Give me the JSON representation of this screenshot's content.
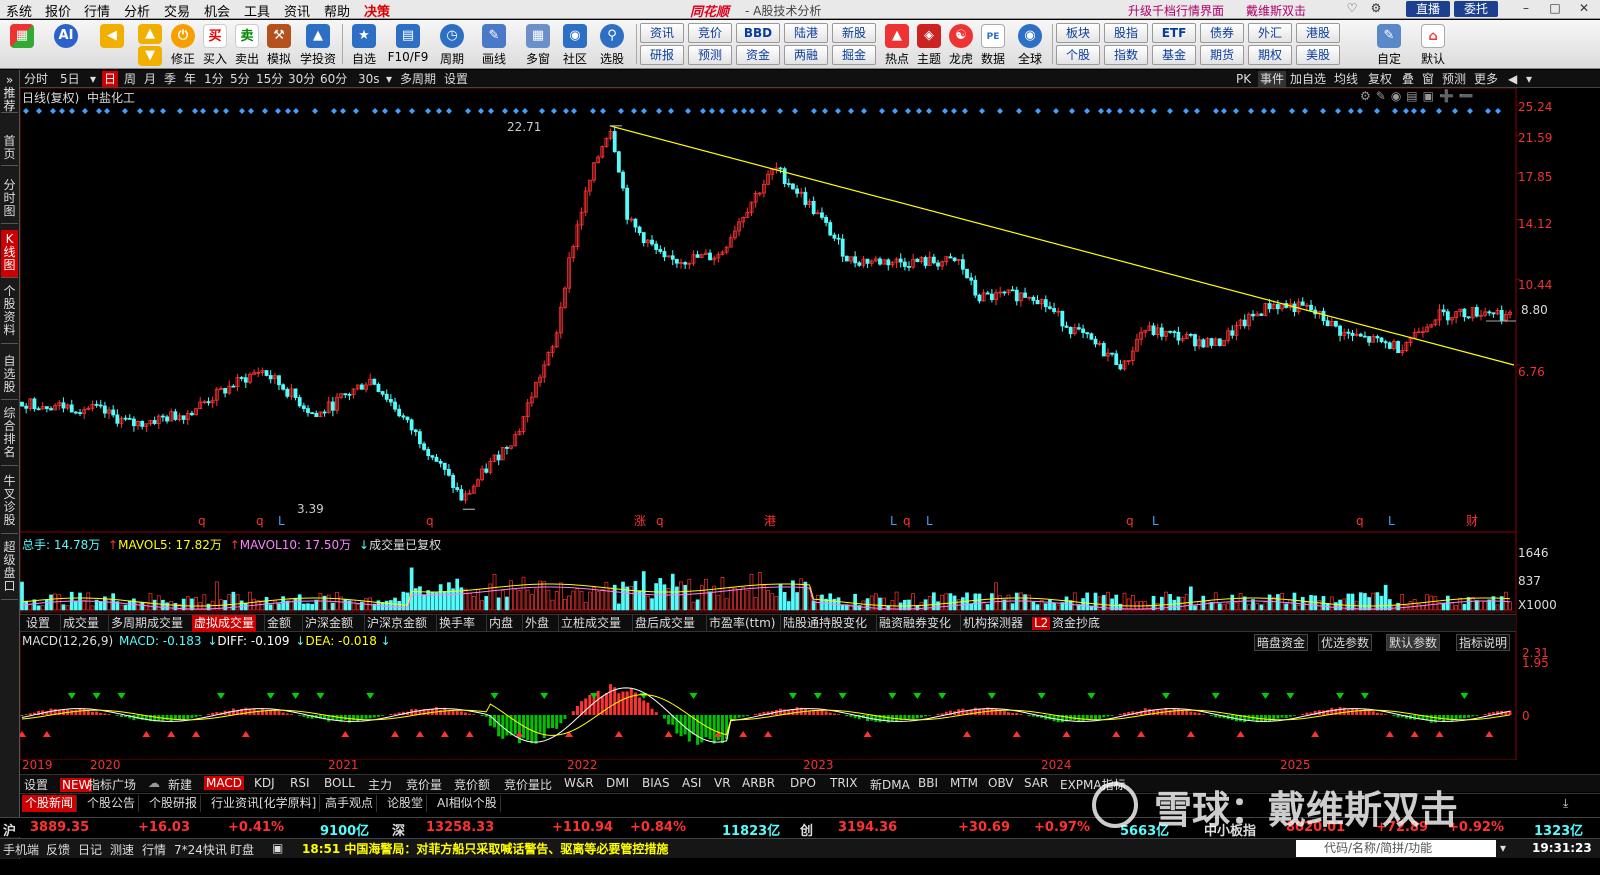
{
  "menubar": {
    "items": [
      "系统",
      "报价",
      "行情",
      "分析",
      "交易",
      "机会",
      "工具",
      "资讯",
      "帮助",
      "决策"
    ],
    "brand": "同花顺",
    "title": "- A股技术分析",
    "promo1": "升级千档行情界面",
    "promo2": "戴维斯双击",
    "btn1": "直播",
    "btn2": "委托"
  },
  "toolbar": {
    "big": [
      "修正",
      "买入",
      "卖出",
      "模拟",
      "学投资",
      "自选",
      "F10/F9",
      "周期",
      "画线",
      "多窗",
      "社区",
      "选股",
      "热点",
      "主题",
      "龙虎",
      "数据",
      "全球"
    ],
    "grid_top": [
      "资讯",
      "竞价",
      "BBD",
      "陆港",
      "新股"
    ],
    "grid_bottom": [
      "研报",
      "预测",
      "资金",
      "两融",
      "掘金"
    ],
    "grid2_top": [
      "板块",
      "股指",
      "ETF",
      "债券",
      "外汇",
      "港股"
    ],
    "grid2_bottom": [
      "个股",
      "指数",
      "基金",
      "期货",
      "期权",
      "美股"
    ],
    "right": [
      "自定",
      "默认"
    ]
  },
  "lefttabs": [
    "推荐",
    "首页",
    "分时图",
    "K线图",
    "个股资料",
    "自选股",
    "综合排名",
    "牛叉诊股",
    "超级盘口"
  ],
  "periods": [
    "分时",
    "5日",
    "日",
    "周",
    "月",
    "季",
    "年",
    "1分",
    "5分",
    "15分",
    "30分",
    "60分",
    "30s",
    "多周期",
    "设置"
  ],
  "period_active": "日",
  "periodbar_right": [
    "PK",
    "事件",
    "加自选",
    "均线",
    "复权",
    "叠",
    "窗",
    "预测",
    "更多"
  ],
  "chart_header": "日线(复权)  中盐化工",
  "price_axis": [
    "25.24",
    "21.59",
    "17.85",
    "14.12",
    "10.44",
    "6.76"
  ],
  "annotations": {
    "high": "22.71",
    "low": "3.39",
    "last": "8.80"
  },
  "event_markers": [
    "q",
    "q",
    "L",
    "q",
    "涨",
    "q",
    "港",
    "L",
    "q",
    "L",
    "q",
    "L",
    "q",
    "L",
    "财"
  ],
  "volume_legend": {
    "total": "总手: 14.78万",
    "mavol5": "MAVOL5: 17.82万",
    "mavol10": "MAVOL10: 17.50万",
    "note": "成交量已复权"
  },
  "volume_axis": [
    "1646",
    "837",
    "X1000"
  ],
  "indicator_tabs": [
    "设置",
    "成交量",
    "多周期成交量",
    "虚拟成交量",
    "金额",
    "沪深金额",
    "沪深京金额",
    "换手率",
    "内盘",
    "外盘",
    "立桩成交量",
    "盘后成交量",
    "市盈率(ttm)",
    "陆股通持股变化",
    "融资融券变化",
    "机构探测器",
    "L2",
    "资金抄底"
  ],
  "indicator_active": "虚拟成交量",
  "macd_legend": {
    "name": "MACD(12,26,9)",
    "macd": "MACD: -0.183",
    "diff": "DIFF: -0.109",
    "dea": "DEA: -0.018"
  },
  "macd_buttons": [
    "暗盘资金",
    "优选参数",
    "默认参数",
    "指标说明"
  ],
  "macd_axis": [
    "2.31",
    "1.95",
    "0"
  ],
  "years": [
    "2019",
    "2020",
    "2021",
    "2022",
    "2023",
    "2024",
    "2025"
  ],
  "indicators": [
    "设置",
    "NEW",
    "指标广场",
    "新建",
    "MACD",
    "KDJ",
    "RSI",
    "BOLL",
    "主力",
    "竞价量",
    "竞价额",
    "竞价量比",
    "W&R",
    "DMI",
    "BIAS",
    "ASI",
    "VR",
    "ARBR",
    "DPO",
    "TRIX",
    "新DMA",
    "BBI",
    "MTM",
    "OBV",
    "SAR",
    "EXPMA指标"
  ],
  "news_tabs": [
    "个股新闻",
    "个股公告",
    "个股研报",
    "行业资讯[化学原料]",
    "高手观点",
    "论股堂",
    "AI相似个股"
  ],
  "watermark": "雪球：戴维斯双击",
  "indices": [
    {
      "name": "沪",
      "value": "3889.35",
      "chg": "+16.03",
      "pct": "+0.41%",
      "amt": "9100亿"
    },
    {
      "name": "深",
      "value": "13258.33",
      "chg": "+110.94",
      "pct": "+0.84%",
      "amt": "11823亿"
    },
    {
      "name": "创",
      "value": "3194.36",
      "chg": "+30.69",
      "pct": "+0.97%",
      "amt": "5663亿"
    },
    {
      "name": "中小板指",
      "value": "8020.01",
      "chg": "+72.89",
      "pct": "+0.92%",
      "amt": "1323亿"
    }
  ],
  "statusbar": {
    "items": [
      "手机端",
      "反馈",
      "日记",
      "测速",
      "行情",
      "7*24快讯",
      "盯盘"
    ],
    "ticker": "18:51 中国海警局：对菲方船只采取喊话警告、驱离等必要管控措施",
    "search": "代码/名称/简拼/功能",
    "clock": "19:31:23"
  },
  "colors": {
    "up": "#ff3232",
    "down": "#54fcfc",
    "trend": "#ffff00",
    "mavol5": "#ffff00",
    "mavol10": "#ff80ff",
    "diff": "#ffffff",
    "dea": "#ffff00"
  },
  "chart_data": {
    "type": "candlestick",
    "title": "日线(复权)  中盐化工",
    "x_range": [
      "2019",
      "2025"
    ],
    "price_range": [
      3.39,
      22.71
    ],
    "price_ticks": [
      25.24,
      21.59,
      17.85,
      14.12,
      10.44,
      6.76
    ],
    "trend_line": {
      "from": 22.71,
      "to": 6.76
    },
    "series_anchors": [
      {
        "x": "2019-01",
        "price": 5.6
      },
      {
        "x": "2019-05",
        "price": 5.4
      },
      {
        "x": "2019-07",
        "price": 5.0
      },
      {
        "x": "2019-10",
        "price": 5.3
      },
      {
        "x": "2020-02",
        "price": 6.6
      },
      {
        "x": "2020-05",
        "price": 5.2
      },
      {
        "x": "2020-08",
        "price": 6.3
      },
      {
        "x": "2020-10",
        "price": 5.0
      },
      {
        "x": "2021-01",
        "price": 3.39
      },
      {
        "x": "2021-04",
        "price": 4.8
      },
      {
        "x": "2021-06",
        "price": 7.5
      },
      {
        "x": "2021-07",
        "price": 12.5
      },
      {
        "x": "2021-09",
        "price": 22.71
      },
      {
        "x": "2021-10",
        "price": 14.0
      },
      {
        "x": "2021-12",
        "price": 11.4
      },
      {
        "x": "2022-03",
        "price": 11.8
      },
      {
        "x": "2022-06",
        "price": 18.3
      },
      {
        "x": "2022-08",
        "price": 15.0
      },
      {
        "x": "2022-10",
        "price": 11.5
      },
      {
        "x": "2023-01",
        "price": 11.4
      },
      {
        "x": "2023-04",
        "price": 11.4
      },
      {
        "x": "2023-05",
        "price": 9.5
      },
      {
        "x": "2023-08",
        "price": 9.7
      },
      {
        "x": "2023-10",
        "price": 8.2
      },
      {
        "x": "2024-01",
        "price": 6.7
      },
      {
        "x": "2024-02",
        "price": 8.1
      },
      {
        "x": "2024-06",
        "price": 7.5
      },
      {
        "x": "2024-09",
        "price": 9.2
      },
      {
        "x": "2024-11",
        "price": 9.0
      },
      {
        "x": "2025-01",
        "price": 7.9
      },
      {
        "x": "2025-04",
        "price": 7.4
      },
      {
        "x": "2025-06",
        "price": 8.7
      },
      {
        "x": "2025-09",
        "price": 8.9
      },
      {
        "x": "2025-10",
        "price": 8.6
      }
    ],
    "volume": {
      "unit": "X1000",
      "ticks": [
        1646,
        837
      ],
      "total": "14.78万",
      "mavol5": "17.82万",
      "mavol10": "17.50万"
    },
    "macd": {
      "params": "12,26,9",
      "macd": -0.183,
      "diff": -0.109,
      "dea": -0.018,
      "ticks": [
        2.31,
        1.95,
        0
      ]
    }
  }
}
